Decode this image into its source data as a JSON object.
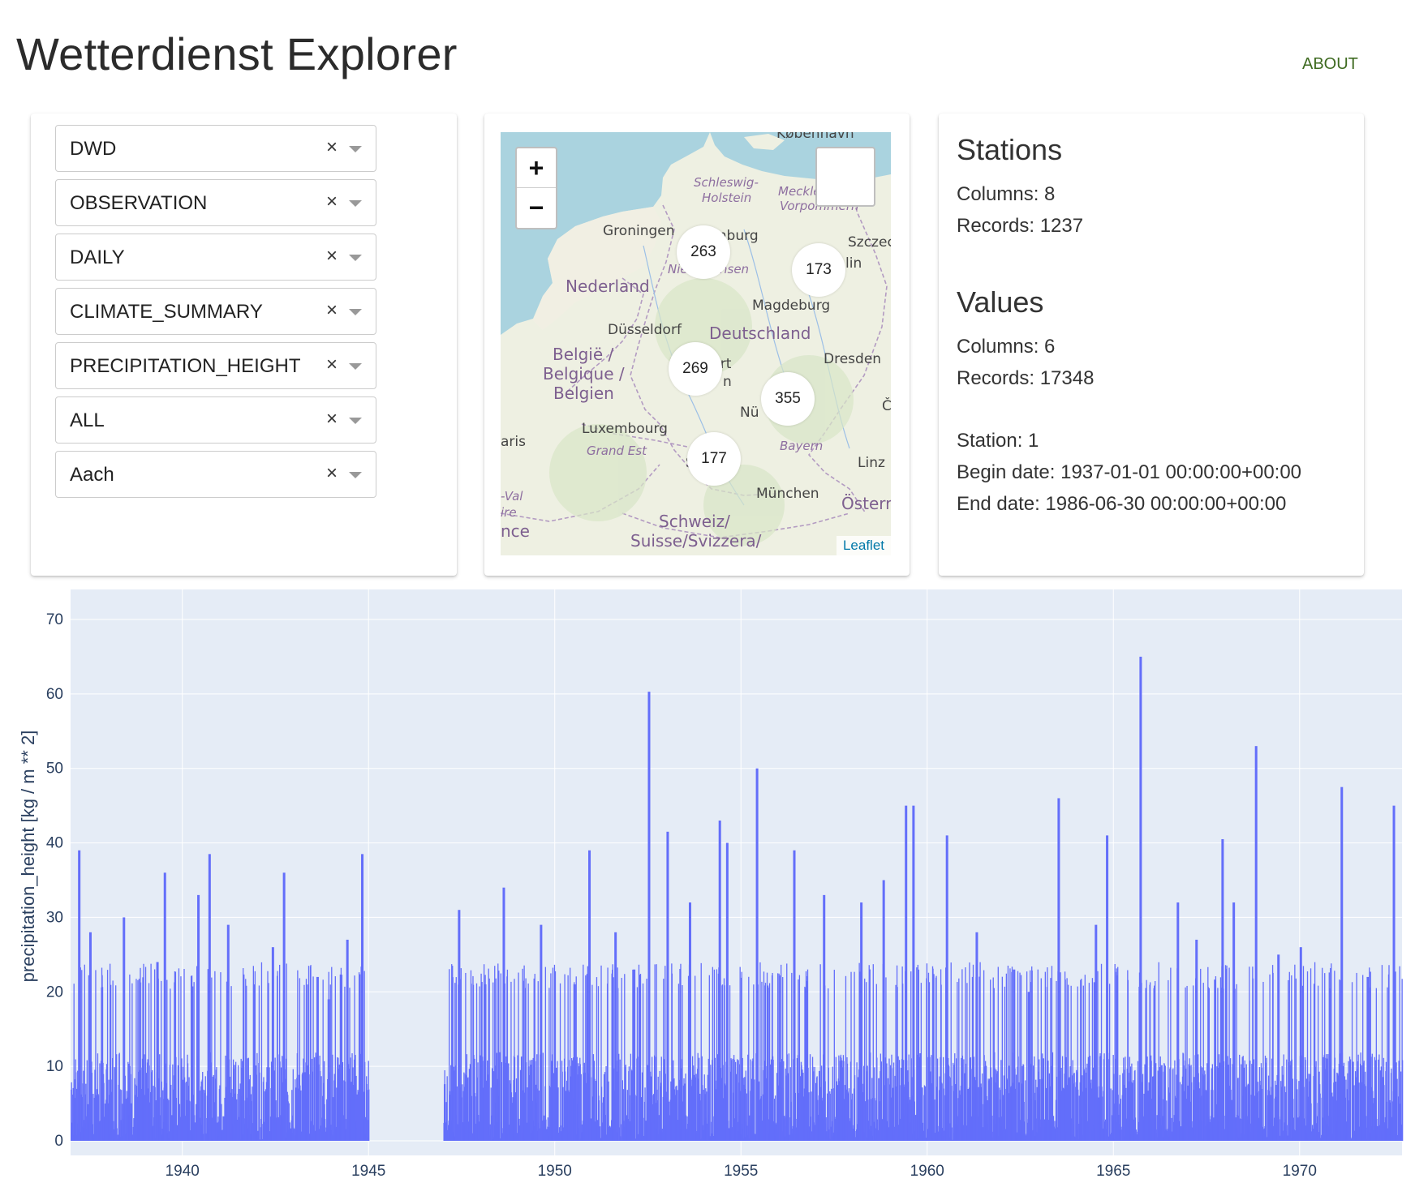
{
  "header": {
    "title": "Wetterdienst Explorer",
    "about_label": "ABOUT"
  },
  "filters": [
    {
      "value": "DWD"
    },
    {
      "value": "OBSERVATION"
    },
    {
      "value": "DAILY"
    },
    {
      "value": "CLIMATE_SUMMARY"
    },
    {
      "value": "PRECIPITATION_HEIGHT"
    },
    {
      "value": "ALL"
    },
    {
      "value": "Aach"
    }
  ],
  "clear_glyph": "×",
  "map": {
    "zoom_in": "+",
    "zoom_out": "−",
    "attribution": "Leaflet",
    "clusters": [
      "263",
      "173",
      "269",
      "355",
      "177"
    ],
    "labels": [
      "Schleswig-",
      "Holstein",
      "Meckle",
      "Vorpommern",
      "Groningen",
      "mburg",
      "Szczec",
      "Nie",
      "hsen",
      "lin",
      "Nederland",
      "Magdeburg",
      "Düsseldorf",
      "Deutschland",
      "België /",
      "Belgique /",
      "Belgien",
      "Dresden",
      "F",
      "urt",
      "n",
      "Luxembourg",
      "Nü",
      "Č",
      "aris",
      "Grand Est",
      "Bayern",
      "Linz",
      "S",
      "rt",
      "-Val",
      "ire",
      "München",
      "Österr",
      "nce",
      "Schweiz/",
      "Suisse/Svizzera/",
      "København"
    ]
  },
  "stations": {
    "heading": "Stations",
    "columns": "Columns: 8",
    "records": "Records: 1237"
  },
  "values": {
    "heading": "Values",
    "columns": "Columns: 6",
    "records": "Records: 17348"
  },
  "station_info": {
    "station": "Station: 1",
    "begin": "Begin date: 1937-01-01 00:00:00+00:00",
    "end": "End date: 1986-06-30 00:00:00+00:00"
  },
  "chart_data": {
    "type": "bar",
    "ylabel": "precipitation_height [kg / m ** 2]",
    "xlabel": "",
    "x_range": [
      1937.0,
      1972.75
    ],
    "ylim": [
      0,
      70
    ],
    "x_ticks": [
      1940,
      1945,
      1950,
      1955,
      1960,
      1965,
      1970
    ],
    "y_ticks": [
      0,
      10,
      20,
      30,
      40,
      50,
      60,
      70
    ],
    "grid": true,
    "bar_color": "#636efa",
    "gap": [
      1945.0,
      1947.0
    ],
    "peaks": [
      {
        "x": 1937.2,
        "y": 39
      },
      {
        "x": 1937.5,
        "y": 28
      },
      {
        "x": 1938.4,
        "y": 30
      },
      {
        "x": 1939.3,
        "y": 24
      },
      {
        "x": 1939.5,
        "y": 36
      },
      {
        "x": 1940.4,
        "y": 33
      },
      {
        "x": 1940.7,
        "y": 38.5
      },
      {
        "x": 1941.2,
        "y": 29
      },
      {
        "x": 1941.9,
        "y": 21
      },
      {
        "x": 1942.4,
        "y": 26
      },
      {
        "x": 1942.7,
        "y": 36
      },
      {
        "x": 1943.6,
        "y": 22
      },
      {
        "x": 1943.9,
        "y": 19
      },
      {
        "x": 1944.4,
        "y": 27
      },
      {
        "x": 1944.8,
        "y": 38.5
      },
      {
        "x": 1947.4,
        "y": 31
      },
      {
        "x": 1948.1,
        "y": 21
      },
      {
        "x": 1948.6,
        "y": 34
      },
      {
        "x": 1949.6,
        "y": 29
      },
      {
        "x": 1950.5,
        "y": 21
      },
      {
        "x": 1950.9,
        "y": 39
      },
      {
        "x": 1951.6,
        "y": 28
      },
      {
        "x": 1952.1,
        "y": 23
      },
      {
        "x": 1952.5,
        "y": 60.3
      },
      {
        "x": 1953.0,
        "y": 41.5
      },
      {
        "x": 1953.6,
        "y": 32
      },
      {
        "x": 1954.4,
        "y": 43
      },
      {
        "x": 1954.6,
        "y": 40
      },
      {
        "x": 1955.4,
        "y": 50
      },
      {
        "x": 1956.4,
        "y": 39
      },
      {
        "x": 1957.2,
        "y": 33
      },
      {
        "x": 1958.2,
        "y": 32
      },
      {
        "x": 1958.8,
        "y": 35
      },
      {
        "x": 1959.4,
        "y": 45
      },
      {
        "x": 1959.6,
        "y": 45
      },
      {
        "x": 1960.5,
        "y": 41
      },
      {
        "x": 1961.3,
        "y": 28
      },
      {
        "x": 1962.3,
        "y": 23
      },
      {
        "x": 1962.7,
        "y": 20
      },
      {
        "x": 1963.5,
        "y": 46
      },
      {
        "x": 1964.5,
        "y": 29
      },
      {
        "x": 1964.8,
        "y": 41
      },
      {
        "x": 1965.7,
        "y": 65
      },
      {
        "x": 1966.7,
        "y": 32
      },
      {
        "x": 1967.2,
        "y": 27
      },
      {
        "x": 1967.9,
        "y": 40.5
      },
      {
        "x": 1968.2,
        "y": 32
      },
      {
        "x": 1968.8,
        "y": 53
      },
      {
        "x": 1969.4,
        "y": 25
      },
      {
        "x": 1970.0,
        "y": 26
      },
      {
        "x": 1971.1,
        "y": 47.5
      },
      {
        "x": 1971.8,
        "y": 22
      },
      {
        "x": 1972.5,
        "y": 45
      }
    ]
  }
}
